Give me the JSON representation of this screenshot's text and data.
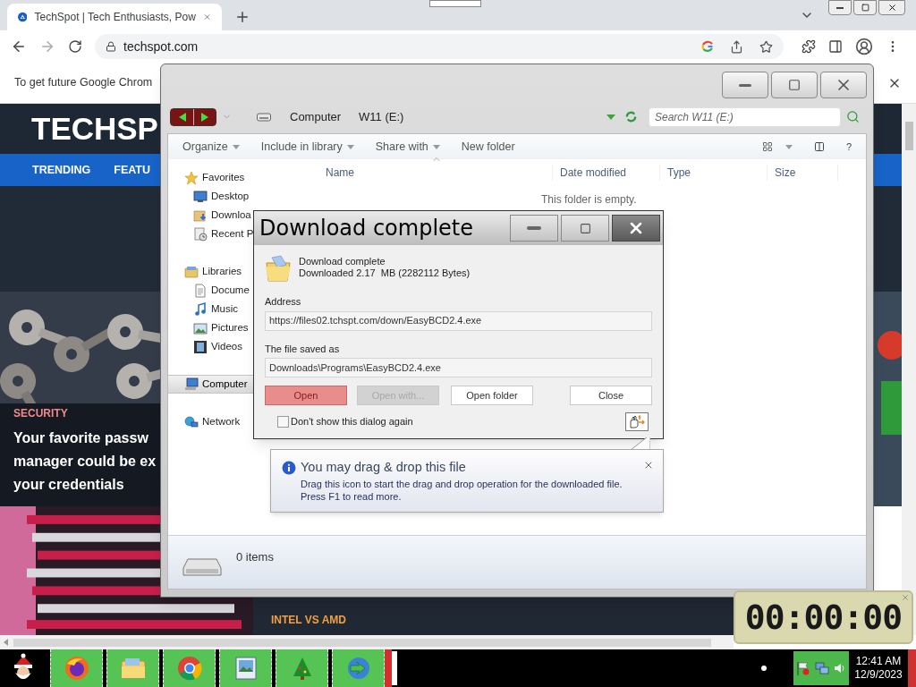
{
  "browser": {
    "tab": {
      "title": "TechSpot | Tech Enthusiasts, Pow",
      "selected": true
    },
    "address": "techspot.com",
    "infobar": "To get future Google Chrom"
  },
  "webpage": {
    "logo": "TECHSP",
    "nav": [
      "TRENDING",
      "FEATU"
    ],
    "article": {
      "category": "SECURITY",
      "headline_lines": [
        "Your favorite passw",
        "manager could be ex",
        "your credentials"
      ]
    },
    "bottom_tag": "INTEL VS AMD"
  },
  "explorer": {
    "breadcrumb": [
      "Computer",
      "W11 (E:)"
    ],
    "search_placeholder": "Search W11 (E:)",
    "toolbar": [
      {
        "label": "Organize",
        "dropdown": true
      },
      {
        "label": "Include in library",
        "dropdown": true
      },
      {
        "label": "Share with",
        "dropdown": true
      },
      {
        "label": "New folder",
        "dropdown": false
      }
    ],
    "help": "?",
    "columns": [
      "Name",
      "Date modified",
      "Type",
      "Size"
    ],
    "empty_message": "This folder is empty.",
    "nav": [
      {
        "label": "Favorites",
        "kind": "star",
        "selected": false,
        "children": [
          {
            "label": "Desktop",
            "kind": "desktop",
            "selected": false
          },
          {
            "label": "Downloa",
            "kind": "downloads",
            "selected": false
          },
          {
            "label": "Recent P",
            "kind": "recent",
            "selected": false
          }
        ]
      },
      {
        "label": "Libraries",
        "kind": "library",
        "selected": false,
        "children": [
          {
            "label": "Docume",
            "kind": "document",
            "selected": false
          },
          {
            "label": "Music",
            "kind": "music",
            "selected": false
          },
          {
            "label": "Pictures",
            "kind": "pictures",
            "selected": false
          },
          {
            "label": "Videos",
            "kind": "videos",
            "selected": false
          }
        ]
      },
      {
        "label": "Computer",
        "kind": "computer",
        "selected": true
      },
      {
        "label": "Network",
        "kind": "network",
        "selected": false
      }
    ],
    "status": "0 items"
  },
  "dialog": {
    "title": "Download complete",
    "heading": "Download complete",
    "detail": "Downloaded 2.17  MB (2282112 Bytes)",
    "address_label": "Address",
    "address": "https://files02.tchspt.com/down/EasyBCD2.4.exe",
    "saved_label": "The file saved as",
    "saved_path": "Downloads\\Programs\\EasyBCD2.4.exe",
    "buttons": [
      {
        "label": "Open",
        "kind": "primary",
        "disabled": false
      },
      {
        "label": "Open with...",
        "kind": "normal",
        "disabled": true
      },
      {
        "label": "Open folder",
        "kind": "normal",
        "disabled": false
      },
      {
        "label": "Close",
        "kind": "normal",
        "disabled": false
      }
    ],
    "dont_show": {
      "label": "Don't show this dialog again",
      "checked": false
    }
  },
  "tooltip": {
    "title": "You may drag & drop this file",
    "lines": [
      "Drag this icon to start the drag and drop operation for the downloaded file.",
      "Press F1 to read more."
    ]
  },
  "timer": {
    "time": "00:00:00"
  },
  "taskbar": {
    "apps": [
      {
        "kind": "firefox"
      },
      {
        "kind": "folder"
      },
      {
        "kind": "chrome"
      },
      {
        "kind": "photos"
      },
      {
        "kind": "tree"
      },
      {
        "kind": "downloader"
      }
    ],
    "clock": {
      "time": "12:41 AM",
      "date": "12/9/2023"
    }
  }
}
